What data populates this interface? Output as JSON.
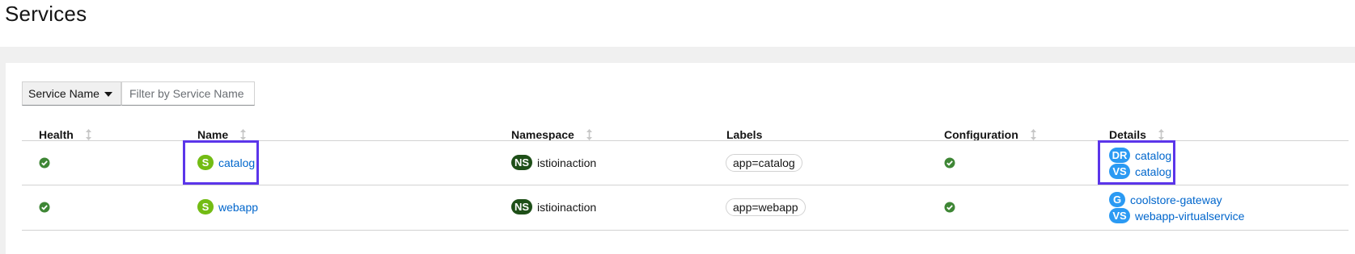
{
  "page": {
    "title": "Services"
  },
  "filter": {
    "select_label": "Service Name",
    "input_placeholder": "Filter by Service Name"
  },
  "table": {
    "columns": [
      "Health",
      "Name",
      "Namespace",
      "Labels",
      "Configuration",
      "Details"
    ],
    "rows": [
      {
        "health": "healthy",
        "name_badge": "S",
        "name": "catalog",
        "namespace_badge": "NS",
        "namespace": "istioinaction",
        "label": "app=catalog",
        "configuration": "valid",
        "details": [
          {
            "badge": "DR",
            "text": "catalog"
          },
          {
            "badge": "VS",
            "text": "catalog"
          }
        ]
      },
      {
        "health": "healthy",
        "name_badge": "S",
        "name": "webapp",
        "namespace_badge": "NS",
        "namespace": "istioinaction",
        "label": "app=webapp",
        "configuration": "valid",
        "details": [
          {
            "badge": "G",
            "text": "coolstore-gateway"
          },
          {
            "badge": "VS",
            "text": "webapp-virtualservice"
          }
        ]
      }
    ]
  },
  "colors": {
    "success": "#3e8635",
    "link": "#0066cc",
    "service_badge": "#73bc14",
    "namespace_badge": "#1e4f18",
    "istio_badge": "#2b9af3",
    "highlight": "#5b35ea"
  }
}
